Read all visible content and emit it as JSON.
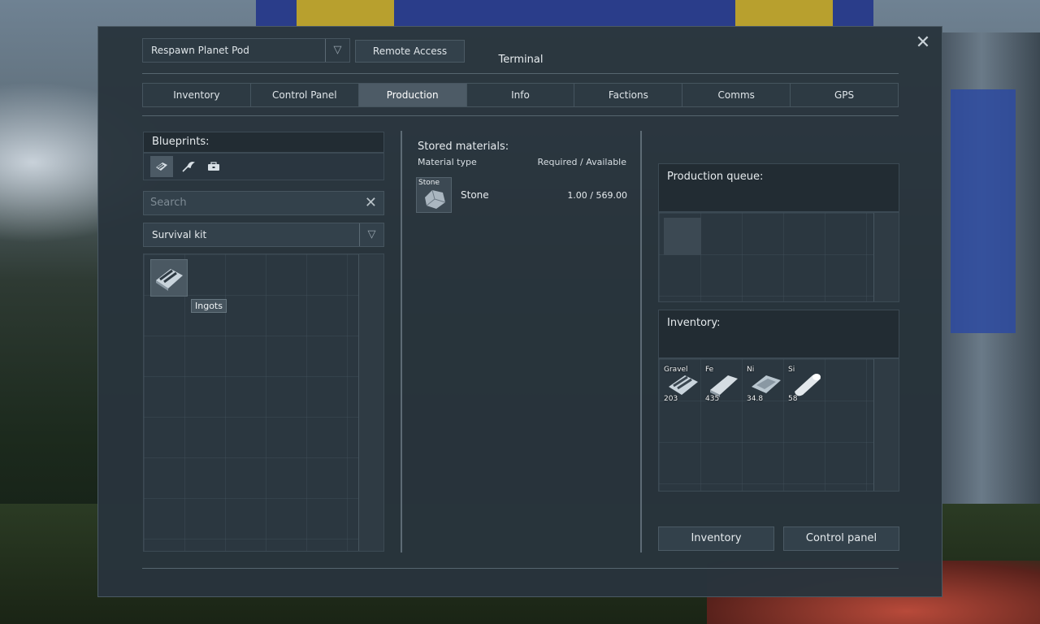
{
  "window": {
    "title": "Terminal",
    "block_selector": "Respawn Planet Pod",
    "remote_access_label": "Remote Access",
    "close_glyph": "✕"
  },
  "tabs": [
    {
      "label": "Inventory",
      "active": false
    },
    {
      "label": "Control Panel",
      "active": false
    },
    {
      "label": "Production",
      "active": true
    },
    {
      "label": "Info",
      "active": false
    },
    {
      "label": "Factions",
      "active": false
    },
    {
      "label": "Comms",
      "active": false
    },
    {
      "label": "GPS",
      "active": false
    }
  ],
  "blueprints": {
    "header": "Blueprints:",
    "filter_icons": [
      "ingot-filter-icon",
      "tool-filter-icon",
      "toolbox-filter-icon"
    ],
    "search_placeholder": "Search",
    "category_selected": "Survival kit",
    "items": [
      {
        "name": "Ingots",
        "icon": "ingot-icon",
        "tooltip": "Ingots"
      }
    ]
  },
  "stored_materials": {
    "title": "Stored materials:",
    "col_material": "Material type",
    "col_amounts": "Required / Available",
    "rows": [
      {
        "icon_label": "Stone",
        "name": "Stone",
        "amount": "1.00 / 569.00"
      }
    ]
  },
  "production_queue": {
    "title": "Production queue:"
  },
  "inventory": {
    "title": "Inventory:",
    "items": [
      {
        "symbol": "Gravel",
        "amount": "203",
        "icon": "gravel-icon"
      },
      {
        "symbol": "Fe",
        "amount": "435",
        "icon": "iron-ingot-icon"
      },
      {
        "symbol": "Ni",
        "amount": "34.8",
        "icon": "nickel-ingot-icon"
      },
      {
        "symbol": "Si",
        "amount": "58",
        "icon": "silicon-wafer-icon"
      }
    ]
  },
  "buttons": {
    "inventory": "Inventory",
    "control_panel": "Control panel"
  },
  "colors": {
    "window_bg": "#29343c",
    "active_tab": "#4d5b66",
    "border": "#46555f"
  }
}
